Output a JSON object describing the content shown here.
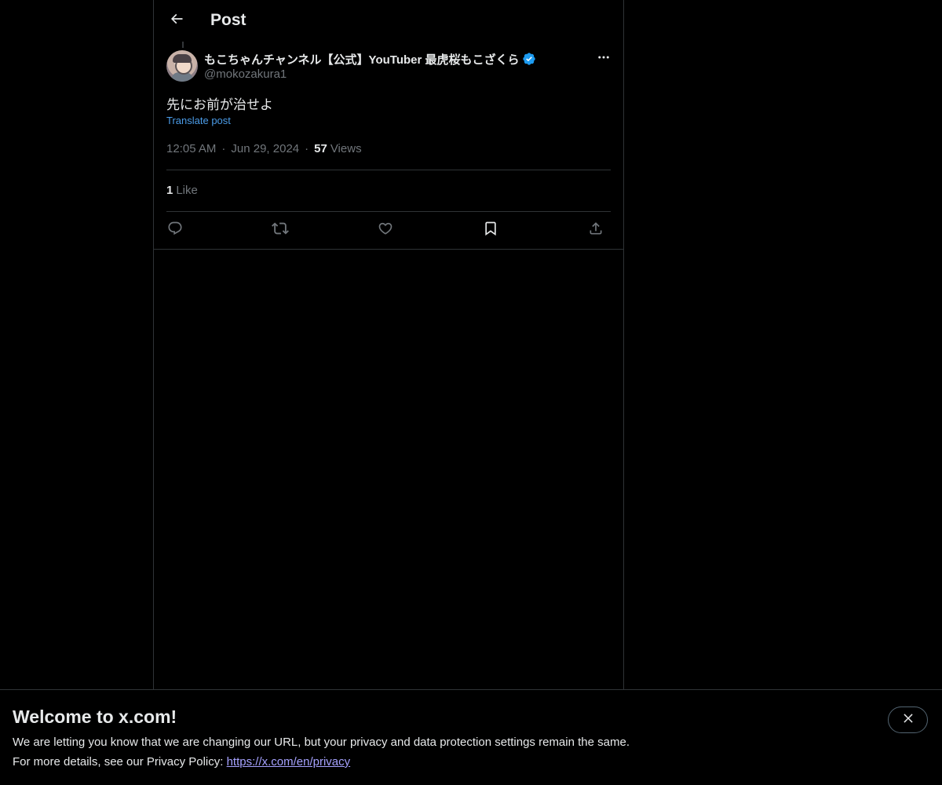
{
  "header": {
    "title": "Post"
  },
  "post": {
    "author": {
      "display_name": "もこちゃんチャンネル【公式】YouTuber 最虎桜もこざくら",
      "handle": "@mokozakura1",
      "verified": true
    },
    "text": "先にお前が治せよ",
    "translate_label": "Translate post",
    "time": "12:05 AM",
    "separator": "·",
    "date": "Jun 29, 2024",
    "views_count": "57",
    "views_label": "Views",
    "likes_count": "1",
    "likes_label": "Like"
  },
  "actions": [
    {
      "icon": "reply-icon"
    },
    {
      "icon": "repost-icon"
    },
    {
      "icon": "like-icon"
    },
    {
      "icon": "bookmark-icon"
    },
    {
      "icon": "share-icon"
    }
  ],
  "banner": {
    "title": "Welcome to x.com!",
    "line1": "We are letting you know that we are changing our URL, but your privacy and data protection settings remain the same.",
    "line2_prefix": "For more details, see our Privacy Policy: ",
    "line2_link": "https://x.com/en/privacy"
  },
  "colors": {
    "background": "#000000",
    "text_primary": "#e7e9ea",
    "text_secondary": "#71767b",
    "link_blue": "#4b9ce8",
    "verified_blue": "#1d9bf0",
    "border": "#2f3336",
    "privacy_link": "#a6a2ff"
  }
}
